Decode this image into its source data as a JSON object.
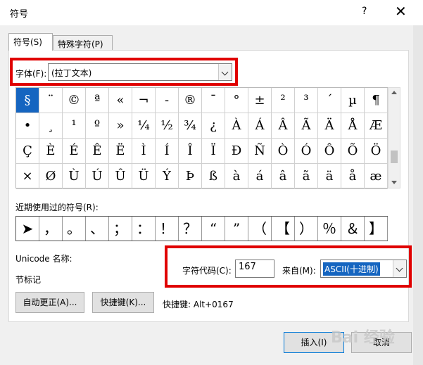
{
  "window": {
    "title": "符号",
    "help": "?",
    "close": "✕"
  },
  "tabs": [
    {
      "label": "符号(S)"
    },
    {
      "label": "特殊字符(P)"
    }
  ],
  "font": {
    "label": "字体(F):",
    "value": "(拉丁文本)"
  },
  "grid": {
    "rows": [
      [
        "§",
        "¨",
        "©",
        "ª",
        "«",
        "¬",
        "-",
        "®",
        "¯",
        "°",
        "±",
        "²",
        "³",
        "´",
        "µ",
        "¶"
      ],
      [
        "•",
        "¸",
        "¹",
        "º",
        "»",
        "¼",
        "½",
        "¾",
        "¿",
        "À",
        "Á",
        "Â",
        "Ã",
        "Ä",
        "Å",
        "Æ"
      ],
      [
        "Ç",
        "È",
        "É",
        "Ê",
        "Ë",
        "Ì",
        "Í",
        "Î",
        "Ï",
        "Ð",
        "Ñ",
        "Ò",
        "Ó",
        "Ô",
        "Õ",
        "Ö"
      ],
      [
        "×",
        "Ø",
        "Ù",
        "Ú",
        "Û",
        "Ü",
        "Ý",
        "Þ",
        "ß",
        "à",
        "á",
        "â",
        "ã",
        "ä",
        "å",
        "æ"
      ]
    ],
    "selected": "§"
  },
  "recent": {
    "label": "近期使用过的符号(R):",
    "symbols": [
      "➤",
      "，",
      "。",
      "、",
      "；",
      "：",
      "！",
      "？",
      "“",
      "”",
      "（",
      "【",
      "）",
      "％",
      "＆",
      "】"
    ]
  },
  "unicode": {
    "label": "Unicode 名称:",
    "name": "节标记"
  },
  "charcode": {
    "label": "字符代码(C):",
    "value": "167",
    "from_label": "来自(M):",
    "from_value": "ASCII(十进制)"
  },
  "buttons": {
    "autocorrect": "自动更正(A)...",
    "shortcut_key": "快捷键(K)...",
    "insert": "插入(I)",
    "cancel": "取消"
  },
  "shortcut": {
    "text": "快捷键: Alt+0167"
  },
  "watermark": {
    "text": "Bai 经验"
  },
  "colors": {
    "highlight": "#e00000",
    "selection": "#1565c0"
  }
}
